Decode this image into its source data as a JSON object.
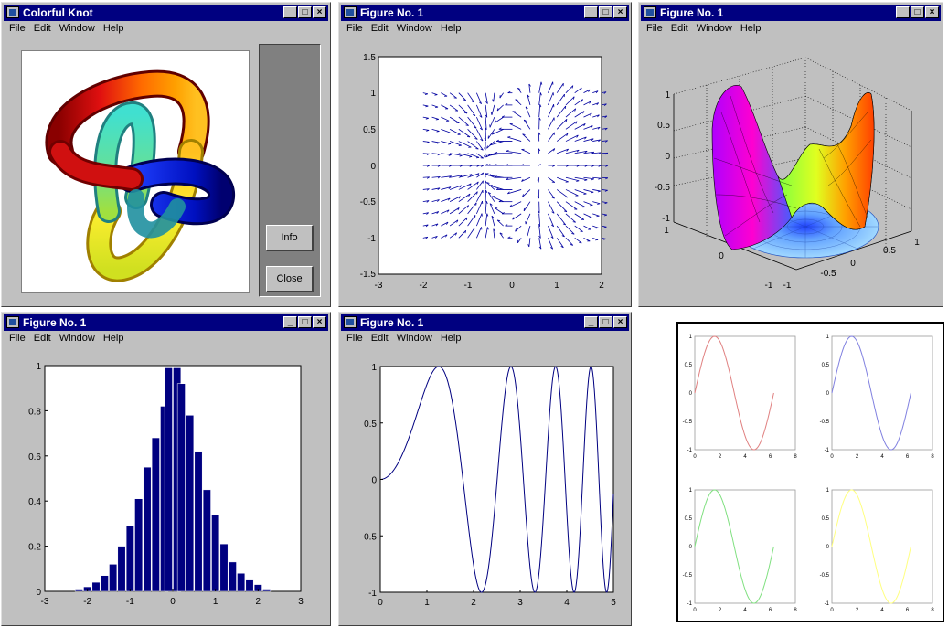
{
  "windows": {
    "knot": {
      "title": "Colorful Knot",
      "menu": [
        "File",
        "Edit",
        "Window",
        "Help"
      ],
      "info_button": "Info",
      "close_button": "Close"
    },
    "quiver": {
      "title": "Figure No. 1",
      "menu": [
        "File",
        "Edit",
        "Window",
        "Help"
      ],
      "x_ticks": [
        "-3",
        "-2",
        "-1",
        "0",
        "1",
        "2"
      ],
      "y_ticks": [
        "1.5",
        "1",
        "0.5",
        "0",
        "-0.5",
        "-1",
        "-1.5"
      ]
    },
    "surface": {
      "title": "Figure No. 1",
      "menu": [
        "File",
        "Edit",
        "Window",
        "Help"
      ],
      "z_ticks": [
        "1",
        "0.5",
        "0",
        "-0.5",
        "-1"
      ],
      "x_ticks": [
        "1",
        "0.5",
        "0",
        "-0.5",
        "-1"
      ],
      "y_ticks": [
        "1",
        "0",
        "-1"
      ]
    },
    "histogram": {
      "title": "Figure No. 1",
      "menu": [
        "File",
        "Edit",
        "Window",
        "Help"
      ]
    },
    "sine": {
      "title": "Figure No. 1",
      "menu": [
        "File",
        "Edit",
        "Window",
        "Help"
      ]
    }
  },
  "chart_data": [
    {
      "type": "bar",
      "x": [
        -2.2,
        -2.0,
        -1.8,
        -1.6,
        -1.4,
        -1.2,
        -1.0,
        -0.8,
        -0.6,
        -0.4,
        -0.2,
        -0.1,
        0.1,
        0.2,
        0.4,
        0.6,
        0.8,
        1.0,
        1.2,
        1.4,
        1.6,
        1.8,
        2.0,
        2.2
      ],
      "values": [
        0.01,
        0.02,
        0.04,
        0.07,
        0.12,
        0.2,
        0.29,
        0.41,
        0.55,
        0.68,
        0.82,
        0.99,
        0.99,
        0.92,
        0.78,
        0.62,
        0.45,
        0.34,
        0.21,
        0.13,
        0.08,
        0.05,
        0.03,
        0.01
      ],
      "xlim": [
        -3,
        3
      ],
      "ylim": [
        0,
        1
      ],
      "xticks": [
        "-3",
        "-2",
        "-1",
        "0",
        "1",
        "2",
        "3"
      ],
      "yticks": [
        "0",
        "0.2",
        "0.4",
        "0.6",
        "0.8",
        "1"
      ],
      "color": "#000080"
    },
    {
      "type": "line",
      "function": "sin(x^2)",
      "xlim": [
        0,
        5
      ],
      "ylim": [
        -1,
        1
      ],
      "xticks": [
        "0",
        "1",
        "2",
        "3",
        "4",
        "5"
      ],
      "yticks": [
        "-1",
        "-0.5",
        "0",
        "0.5",
        "1"
      ],
      "color": "#000080"
    },
    {
      "type": "line",
      "subplots": [
        {
          "function": "sin(x)",
          "xlim": [
            0,
            8
          ],
          "ylim": [
            -1,
            1
          ],
          "color": "#e08080"
        },
        {
          "function": "sin(x)",
          "xlim": [
            0,
            8
          ],
          "ylim": [
            -1,
            1
          ],
          "color": "#8080e0"
        },
        {
          "function": "sin(x)",
          "xlim": [
            0,
            8
          ],
          "ylim": [
            -1,
            1
          ],
          "color": "#80e080"
        },
        {
          "function": "sin(x)",
          "xlim": [
            0,
            8
          ],
          "ylim": [
            -1,
            1
          ],
          "color": "#ffff80"
        }
      ],
      "xticks": [
        "0",
        "2",
        "4",
        "6",
        "8"
      ],
      "yticks": [
        "-1",
        "-0.5",
        "0",
        "0.5",
        "1"
      ]
    }
  ]
}
